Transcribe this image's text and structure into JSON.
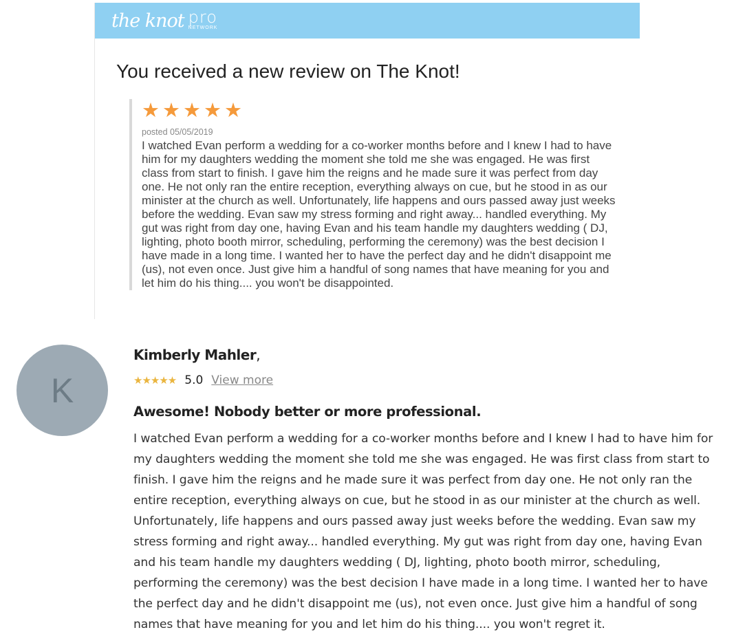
{
  "email": {
    "logo": {
      "script": "the knot",
      "pro": "pro",
      "network": "NETWORK"
    },
    "title": "You received a new review on The Knot!",
    "star_count": 5,
    "star_color": "#f59a3b",
    "posted": "posted 05/05/2019",
    "body": "I watched Evan perform a wedding for a co-worker months before and I knew I had to have him for my daughters wedding the moment she told me she was engaged. He was first class from start to finish. I gave him the reigns and he made sure it was perfect from day one. He not only ran the entire reception, everything always on cue, but he stood in as our minister at the church as well. Unfortunately, life happens and ours passed away just weeks before the wedding. Evan saw my stress forming and right away... handled everything. My gut was right from day one, having Evan and his team handle my daughters wedding ( DJ, lighting, photo booth mirror, scheduling, performing the ceremony) was the best decision I have made in a long time. I wanted her to have the perfect day and he didn't disappoint me (us), not even once. Just give him a handful of song names that have meaning for you and let him do his thing.... you won't be disappointed."
  },
  "review": {
    "avatar_letter": "K",
    "avatar_color": "#9daab4",
    "name": "Kimberly Mahler",
    "name_suffix": ",",
    "stars": "★★★★★",
    "star_color": "#eab53f",
    "rating": "5.0",
    "view_more": "View more",
    "heading": "Awesome! Nobody better or more professional.",
    "body": "I watched Evan perform a wedding for a co-worker months before and I knew I had to have him for my daughters wedding the moment she told me she was engaged. He was first class from start to finish. I gave him the reigns and he made sure it was perfect from day one. He not only ran the entire reception, everything always on cue, but he stood in as our minister at the church as well. Unfortunately, life happens and ours passed away just weeks before the wedding. Evan saw my stress forming and right away... handled everything. My gut was right from day one, having Evan and his team handle my daughters wedding ( DJ, lighting, photo booth mirror, scheduling, performing the ceremony) was the best decision I have made in a long time. I wanted her to have the perfect day and he didn't disappoint me (us), not even once. Just give him a handful of song names that have meaning for you and let him do his thing.... you won't regret it."
  }
}
